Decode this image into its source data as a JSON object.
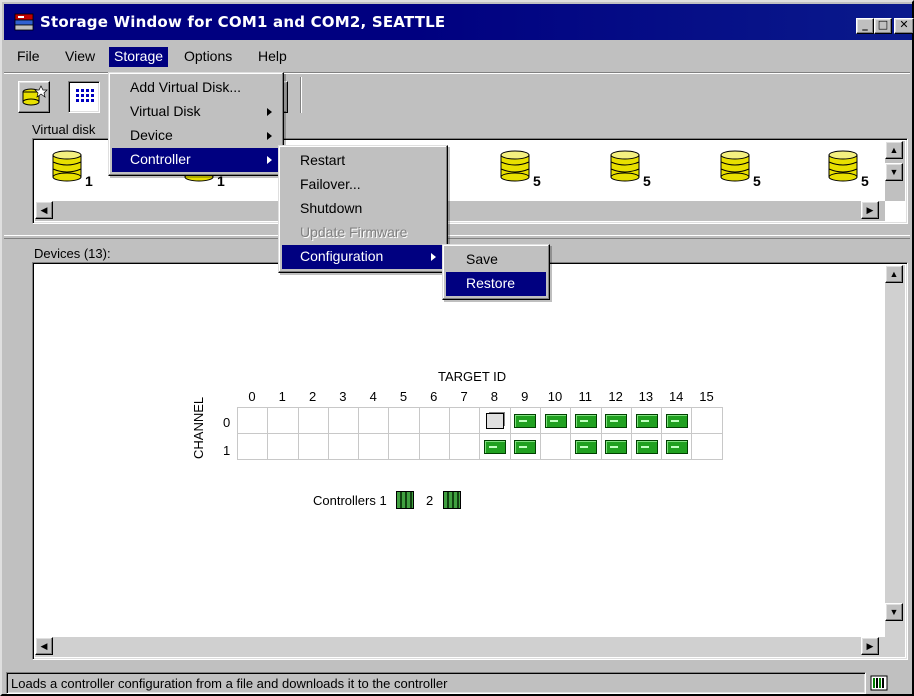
{
  "window": {
    "title": "Storage Window for COM1 and COM2, SEATTLE",
    "icon": "storage-app-icon",
    "controls": [
      "minimize",
      "maximize",
      "close"
    ]
  },
  "menubar": {
    "items": [
      "File",
      "View",
      "Storage",
      "Options",
      "Help"
    ],
    "active": "Storage"
  },
  "toolbar": {
    "buttons": [
      "add-disk-icon",
      "grid-view-icon",
      "list-view-icon"
    ]
  },
  "virtual_disks": {
    "label": "Virtual disk",
    "disks": [
      {
        "icon": "disk-stack-icon",
        "number": "1"
      },
      {
        "icon": "disk-stack-icon",
        "number": "1"
      },
      {
        "icon": "disk-stack-icon",
        "number": "5"
      },
      {
        "icon": "disk-stack-icon",
        "number": "5"
      },
      {
        "icon": "disk-stack-icon",
        "number": "5"
      },
      {
        "icon": "disk-stack-icon",
        "number": "5"
      },
      {
        "icon": "disk-stack-icon",
        "number": "5"
      }
    ]
  },
  "devices": {
    "label": "Devices (13):",
    "target_title": "TARGET ID",
    "channel_title": "CHANNEL",
    "target_ids": [
      "0",
      "1",
      "2",
      "3",
      "4",
      "5",
      "6",
      "7",
      "8",
      "9",
      "10",
      "11",
      "12",
      "13",
      "14",
      "15"
    ],
    "channels": [
      {
        "label": "0",
        "cells": [
          "",
          "",
          "",
          "",
          "",
          "",
          "",
          "",
          "controller",
          "disk",
          "disk",
          "disk",
          "disk",
          "disk",
          "disk",
          ""
        ]
      },
      {
        "label": "1",
        "cells": [
          "",
          "",
          "",
          "",
          "",
          "",
          "",
          "",
          "disk",
          "disk",
          "",
          "disk",
          "disk",
          "disk",
          "disk",
          ""
        ]
      }
    ],
    "controllers_label": "Controllers",
    "controllers": [
      "1",
      "2"
    ]
  },
  "menus": {
    "storage": {
      "items": [
        {
          "label": "Add Virtual Disk...",
          "submenu": false
        },
        {
          "label": "Virtual Disk",
          "submenu": true
        },
        {
          "label": "Device",
          "submenu": true
        },
        {
          "label": "Controller",
          "submenu": true,
          "highlighted": true
        }
      ]
    },
    "controller": {
      "items": [
        {
          "label": "Restart",
          "enabled": true
        },
        {
          "label": "Failover...",
          "enabled": true
        },
        {
          "label": "Shutdown",
          "enabled": true
        },
        {
          "label": "Update Firmware",
          "enabled": false
        },
        {
          "label": "Configuration",
          "submenu": true,
          "highlighted": true
        }
      ]
    },
    "configuration": {
      "items": [
        {
          "label": "Save",
          "highlighted": false
        },
        {
          "label": "Restore",
          "highlighted": true
        }
      ]
    }
  },
  "status": {
    "text": "Loads a controller configuration from a file and downloads it to the controller",
    "icon": "controller-status-icon"
  },
  "colors": {
    "titlebar": "#000080",
    "highlight": "#000080",
    "device_green": "#20a020",
    "face": "#c0c0c0"
  }
}
